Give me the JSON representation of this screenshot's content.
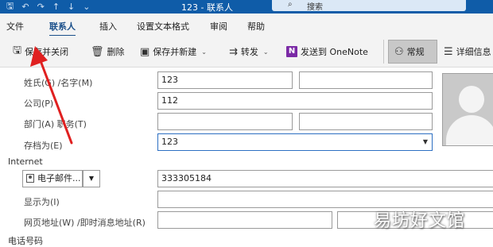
{
  "titlebar": {
    "title": "123 - 联系人",
    "search_placeholder": "搜索",
    "icons": [
      "save-icon",
      "undo-icon",
      "redo-icon",
      "up-icon",
      "down-icon"
    ],
    "accent": "#0f5ca8"
  },
  "menu": {
    "tabs": [
      "文件",
      "联系人",
      "插入",
      "设置文本格式",
      "审阅",
      "帮助"
    ],
    "active": "联系人"
  },
  "ribbon": {
    "save_close": "保存并关闭",
    "delete": "删除",
    "save_new": "保存并新建",
    "forward": "转发",
    "send_onenote": "发送到 OneNote",
    "general": "常规",
    "details": "详细信息"
  },
  "form": {
    "name_label": "姓氏(G) /名字(M)",
    "last_name": "123",
    "first_name": "",
    "company_label": "公司(P)",
    "company": "112",
    "department_label": "部门(A) 职务(T)",
    "department": "",
    "job_title": "",
    "file_as_label": "存档为(E)",
    "file_as": "123",
    "internet_section": "Internet",
    "email_selector": "电子邮件...",
    "email": "333305184",
    "display_as_label": "显示为(I)",
    "display_as": "",
    "web_label": "网页地址(W) /即时消息地址(R)",
    "web": "",
    "im": "",
    "phone_section": "电话号码"
  },
  "watermark": "易坊好文馆"
}
